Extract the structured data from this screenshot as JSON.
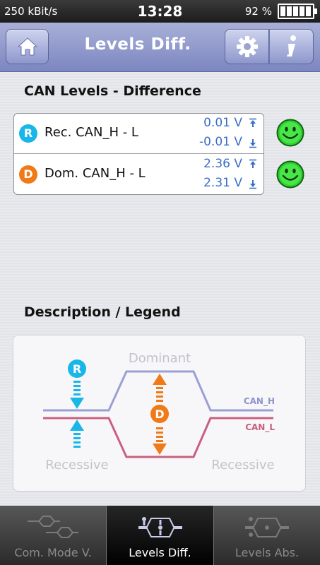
{
  "status": {
    "bitrate": "250 kBit/s",
    "time": "13:28",
    "battery": "92 %",
    "battery_level": 0.92
  },
  "header": {
    "title": "Levels Diff.",
    "home_icon": "home-icon",
    "settings_icon": "gear-icon",
    "info_icon": "info-icon"
  },
  "levels": {
    "title": "CAN Levels - Difference",
    "rows": [
      {
        "badge": "R",
        "label": "Rec. CAN_H - L",
        "max": "0.01 V",
        "min": "-0.01 V",
        "status": "ok",
        "badge_color": "#19b7e9"
      },
      {
        "badge": "D",
        "label": "Dom. CAN_H - L",
        "max": "2.36 V",
        "min": "2.31 V",
        "status": "ok",
        "badge_color": "#f07a17"
      }
    ]
  },
  "legend": {
    "title": "Description / Legend",
    "dominant": "Dominant",
    "recessive_left": "Recessive",
    "recessive_right": "Recessive",
    "can_h": "CAN_H",
    "can_l": "CAN_L",
    "badge_r": "R",
    "badge_d": "D",
    "colors": {
      "can_h": "#9a9fd4",
      "can_l": "#c8607e",
      "recessive": "#19b7e9",
      "dominant": "#f07a17"
    }
  },
  "tabs": [
    {
      "label": "Com. Mode V.",
      "active": false
    },
    {
      "label": "Levels Diff.",
      "active": true
    },
    {
      "label": "Levels Abs.",
      "active": false
    }
  ],
  "colors": {
    "accent": "#7c86c0",
    "value_text": "#3a6fc8"
  }
}
